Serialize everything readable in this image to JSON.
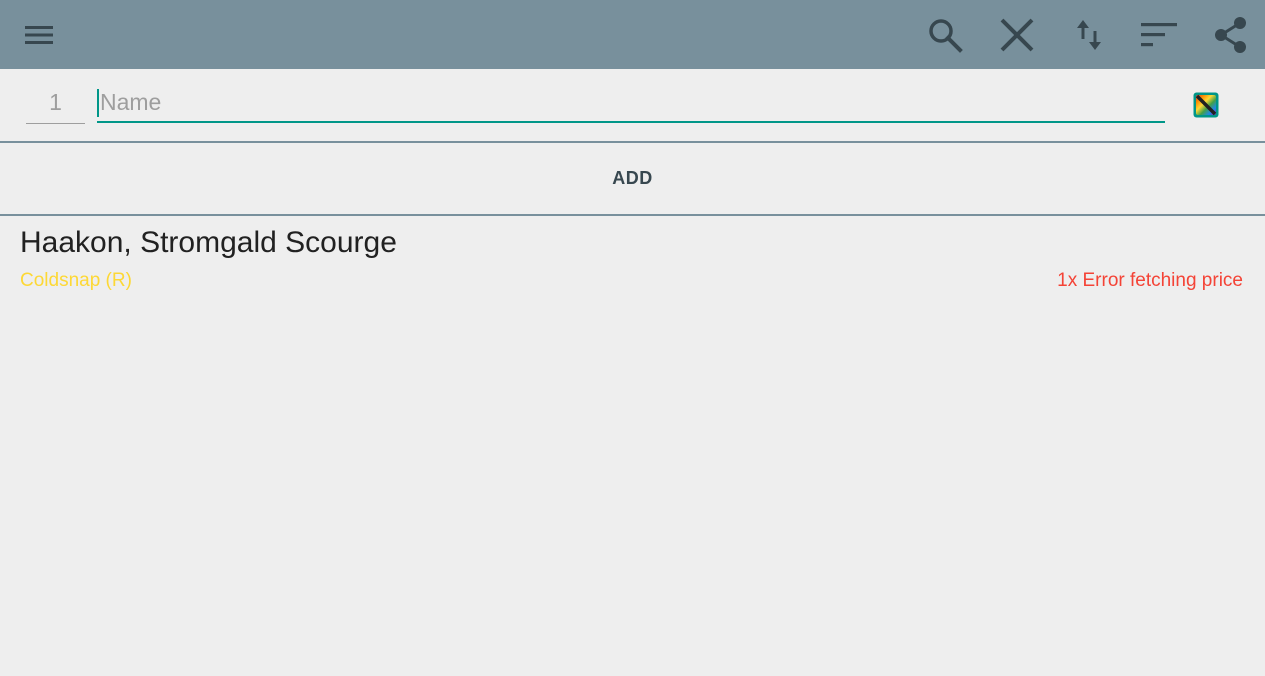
{
  "toolbar": {
    "background": "#78909c",
    "icons": [
      "menu-icon",
      "search-icon",
      "close-icon",
      "swap-vert-icon",
      "sort-icon",
      "share-icon"
    ]
  },
  "input": {
    "quantity": "1",
    "name_placeholder": "Name",
    "name_value": "",
    "accent": "#009688",
    "color_picker_icon": "color-wheel-icon"
  },
  "add_button": {
    "label": "ADD"
  },
  "cards": [
    {
      "name": "Haakon, Stromgald Scourge",
      "set": "Coldsnap (R)",
      "price": "1x Error fetching price",
      "set_color": "#fdd835",
      "price_color": "#f44336"
    }
  ]
}
